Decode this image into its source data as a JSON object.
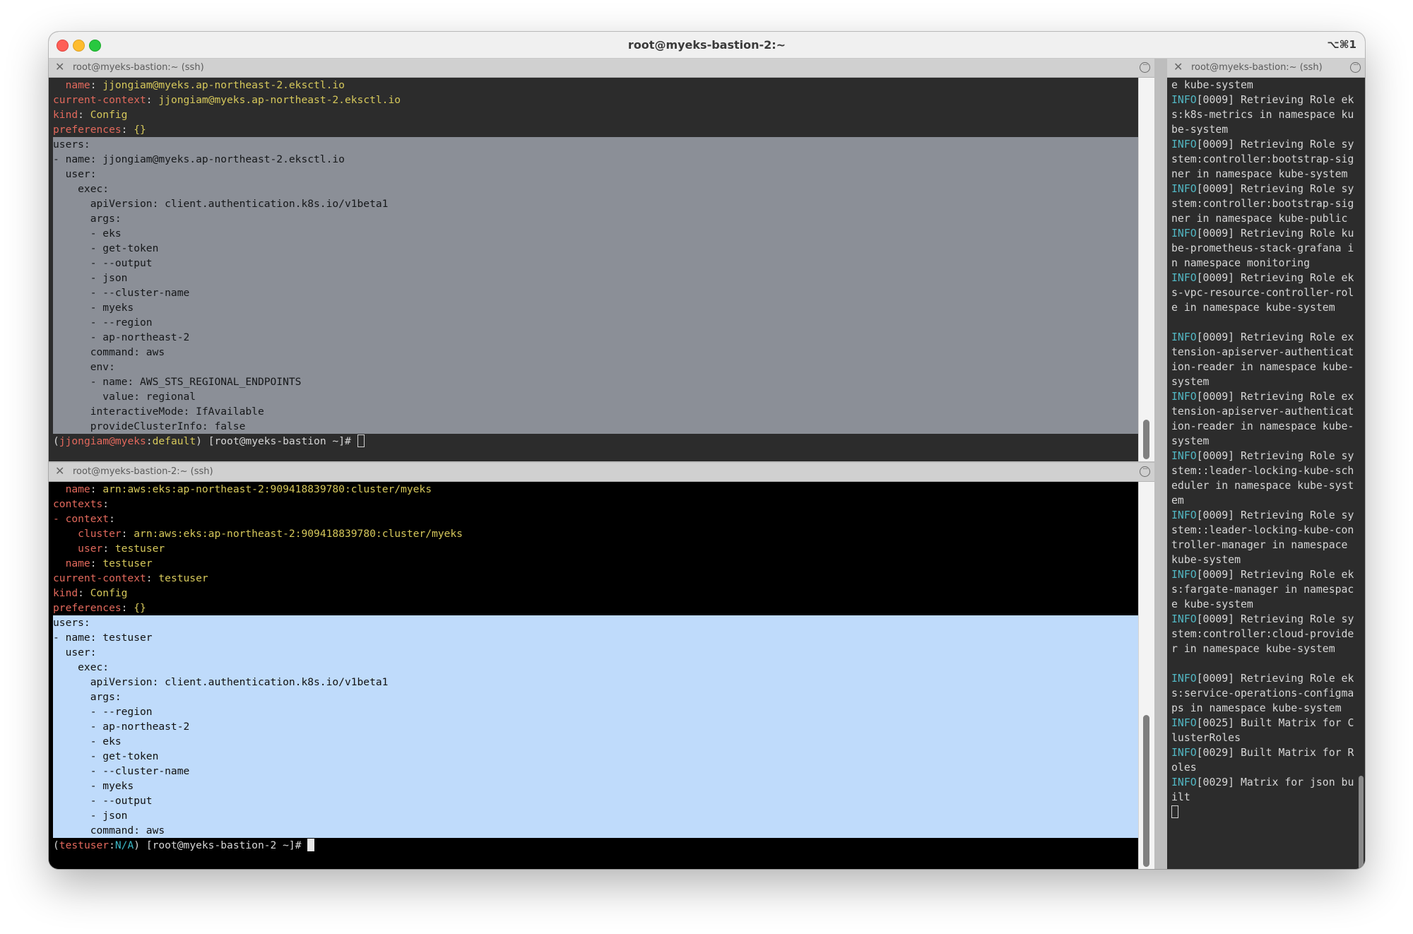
{
  "window": {
    "title": "root@myeks-bastion-2:~",
    "shortcut": "⌥⌘1"
  },
  "colors": {
    "key_red": "#e2695c",
    "key_yellow": "#c9c35e",
    "value_yellow": "#d6c85b",
    "info_cyan": "#52b8c4",
    "prompt_user": "#e2685c",
    "prompt_cluster": "#3bb8c6",
    "plain": "#d6d6d6",
    "pane1_bg": "#2c2c2c",
    "pane2_bg": "#000000",
    "pane3_bg": "#2c2c2c",
    "selection_gray": "#8b8f97",
    "selection_blue": "#bfdbfb"
  },
  "panes": [
    {
      "tab_label": "root@myeks-bastion:~ (ssh)",
      "lines": [
        {
          "seg": [
            {
              "t": "  "
            },
            {
              "t": "name",
              "c": "key_red"
            },
            {
              "t": ": "
            },
            {
              "t": "jjongiam@myeks.ap-northeast-2.eksctl.io",
              "c": "value_yellow"
            }
          ]
        },
        {
          "seg": [
            {
              "t": "current-context",
              "c": "key_red"
            },
            {
              "t": ": "
            },
            {
              "t": "jjongiam@myeks.ap-northeast-2.eksctl.io",
              "c": "value_yellow"
            }
          ]
        },
        {
          "seg": [
            {
              "t": "kind",
              "c": "key_red"
            },
            {
              "t": ": "
            },
            {
              "t": "Config",
              "c": "value_yellow"
            }
          ]
        },
        {
          "seg": [
            {
              "t": "preferences",
              "c": "key_red"
            },
            {
              "t": ": "
            },
            {
              "t": "{}",
              "c": "value_yellow"
            }
          ]
        },
        {
          "sel": true,
          "seg": [
            {
              "t": "users:"
            }
          ]
        },
        {
          "sel": true,
          "seg": [
            {
              "t": "- name: jjongiam@myeks.ap-northeast-2.eksctl.io"
            }
          ]
        },
        {
          "sel": true,
          "seg": [
            {
              "t": "  user:"
            }
          ]
        },
        {
          "sel": true,
          "seg": [
            {
              "t": "    exec:"
            }
          ]
        },
        {
          "sel": true,
          "seg": [
            {
              "t": "      apiVersion: client.authentication.k8s.io/v1beta1"
            }
          ]
        },
        {
          "sel": true,
          "seg": [
            {
              "t": "      args:"
            }
          ]
        },
        {
          "sel": true,
          "seg": [
            {
              "t": "      - eks"
            }
          ]
        },
        {
          "sel": true,
          "seg": [
            {
              "t": "      - get-token"
            }
          ]
        },
        {
          "sel": true,
          "seg": [
            {
              "t": "      - --output"
            }
          ]
        },
        {
          "sel": true,
          "seg": [
            {
              "t": "      - json"
            }
          ]
        },
        {
          "sel": true,
          "seg": [
            {
              "t": "      - --cluster-name"
            }
          ]
        },
        {
          "sel": true,
          "seg": [
            {
              "t": "      - myeks"
            }
          ]
        },
        {
          "sel": true,
          "seg": [
            {
              "t": "      - --region"
            }
          ]
        },
        {
          "sel": true,
          "seg": [
            {
              "t": "      - ap-northeast-2"
            }
          ]
        },
        {
          "sel": true,
          "seg": [
            {
              "t": "      command: aws"
            }
          ]
        },
        {
          "sel": true,
          "seg": [
            {
              "t": "      env:"
            }
          ]
        },
        {
          "sel": true,
          "seg": [
            {
              "t": "      - name: AWS_STS_REGIONAL_ENDPOINTS"
            }
          ]
        },
        {
          "sel": true,
          "seg": [
            {
              "t": "        value: regional"
            }
          ]
        },
        {
          "sel": true,
          "seg": [
            {
              "t": "      interactiveMode: IfAvailable"
            }
          ]
        },
        {
          "sel": true,
          "seg": [
            {
              "t": "      provideClusterInfo: false"
            }
          ]
        },
        {
          "cursor": "hollow",
          "seg": [
            {
              "t": "("
            },
            {
              "t": "jjongiam@myeks",
              "c": "prompt_user"
            },
            {
              "t": ":"
            },
            {
              "t": "default",
              "c": "value_yellow"
            },
            {
              "t": ") [root@myeks-bastion ~]# "
            }
          ]
        }
      ]
    },
    {
      "tab_label": "root@myeks-bastion-2:~ (ssh)",
      "lines": [
        {
          "seg": [
            {
              "t": "  "
            },
            {
              "t": "name",
              "c": "key_red"
            },
            {
              "t": ": "
            },
            {
              "t": "arn:aws:eks:ap-northeast-2:909418839780:cluster/myeks",
              "c": "value_yellow"
            }
          ]
        },
        {
          "seg": [
            {
              "t": "contexts",
              "c": "key_red"
            },
            {
              "t": ":"
            }
          ]
        },
        {
          "seg": [
            {
              "t": "- ",
              "c": "key_red"
            },
            {
              "t": "context",
              "c": "key_red"
            },
            {
              "t": ":"
            }
          ]
        },
        {
          "seg": [
            {
              "t": "    "
            },
            {
              "t": "cluster",
              "c": "key_red"
            },
            {
              "t": ": "
            },
            {
              "t": "arn:aws:eks:ap-northeast-2:909418839780:cluster/myeks",
              "c": "value_yellow"
            }
          ]
        },
        {
          "seg": [
            {
              "t": "    "
            },
            {
              "t": "user",
              "c": "key_red"
            },
            {
              "t": ": "
            },
            {
              "t": "testuser",
              "c": "value_yellow"
            }
          ]
        },
        {
          "seg": [
            {
              "t": "  "
            },
            {
              "t": "name",
              "c": "key_red"
            },
            {
              "t": ": "
            },
            {
              "t": "testuser",
              "c": "value_yellow"
            }
          ]
        },
        {
          "seg": [
            {
              "t": "current-context",
              "c": "key_red"
            },
            {
              "t": ": "
            },
            {
              "t": "testuser",
              "c": "value_yellow"
            }
          ]
        },
        {
          "seg": [
            {
              "t": "kind",
              "c": "key_red"
            },
            {
              "t": ": "
            },
            {
              "t": "Config",
              "c": "value_yellow"
            }
          ]
        },
        {
          "seg": [
            {
              "t": "preferences",
              "c": "key_red"
            },
            {
              "t": ": "
            },
            {
              "t": "{}",
              "c": "value_yellow"
            }
          ]
        },
        {
          "sel": true,
          "seg": [
            {
              "t": "users:"
            }
          ]
        },
        {
          "sel": true,
          "seg": [
            {
              "t": "- name: testuser"
            }
          ]
        },
        {
          "sel": true,
          "seg": [
            {
              "t": "  user:"
            }
          ]
        },
        {
          "sel": true,
          "seg": [
            {
              "t": "    exec:"
            }
          ]
        },
        {
          "sel": true,
          "seg": [
            {
              "t": "      apiVersion: client.authentication.k8s.io/v1beta1"
            }
          ]
        },
        {
          "sel": true,
          "seg": [
            {
              "t": "      args:"
            }
          ]
        },
        {
          "sel": true,
          "seg": [
            {
              "t": "      - --region"
            }
          ]
        },
        {
          "sel": true,
          "seg": [
            {
              "t": "      - ap-northeast-2"
            }
          ]
        },
        {
          "sel": true,
          "seg": [
            {
              "t": "      - eks"
            }
          ]
        },
        {
          "sel": true,
          "seg": [
            {
              "t": "      - get-token"
            }
          ]
        },
        {
          "sel": true,
          "seg": [
            {
              "t": "      - --cluster-name"
            }
          ]
        },
        {
          "sel": true,
          "seg": [
            {
              "t": "      - myeks"
            }
          ]
        },
        {
          "sel": true,
          "seg": [
            {
              "t": "      - --output"
            }
          ]
        },
        {
          "sel": true,
          "seg": [
            {
              "t": "      - json"
            }
          ]
        },
        {
          "sel": true,
          "seg": [
            {
              "t": "      command: aws"
            }
          ]
        },
        {
          "cursor": "block",
          "seg": [
            {
              "t": "("
            },
            {
              "t": "testuser",
              "c": "prompt_user"
            },
            {
              "t": ":"
            },
            {
              "t": "N/A",
              "c": "prompt_cluster"
            },
            {
              "t": ") [root@myeks-bastion-2 ~]# "
            }
          ]
        }
      ]
    },
    {
      "tab_label": "root@myeks-bastion:~ (ssh)",
      "lines": [
        {
          "seg": [
            {
              "t": "e kube-system"
            }
          ]
        },
        {
          "seg": [
            {
              "t": "INFO",
              "c": "info_cyan"
            },
            {
              "t": "[0009] Retrieving Role eks:k8s-metrics in namespace kube-system"
            }
          ]
        },
        {
          "seg": [
            {
              "t": "INFO",
              "c": "info_cyan"
            },
            {
              "t": "[0009] Retrieving Role system:controller:bootstrap-signer in namespace kube-system"
            }
          ]
        },
        {
          "seg": [
            {
              "t": "INFO",
              "c": "info_cyan"
            },
            {
              "t": "[0009] Retrieving Role system:controller:bootstrap-signer in namespace kube-public"
            }
          ]
        },
        {
          "seg": [
            {
              "t": "INFO",
              "c": "info_cyan"
            },
            {
              "t": "[0009] Retrieving Role kube-prometheus-stack-grafana in namespace monitoring"
            }
          ]
        },
        {
          "seg": [
            {
              "t": "INFO",
              "c": "info_cyan"
            },
            {
              "t": "[0009] Retrieving Role eks-vpc-resource-controller-role in namespace kube-system"
            }
          ]
        },
        {
          "seg": [
            {
              "t": " "
            }
          ]
        },
        {
          "seg": [
            {
              "t": "INFO",
              "c": "info_cyan"
            },
            {
              "t": "[0009] Retrieving Role extension-apiserver-authentication-reader in namespace kube-system"
            }
          ]
        },
        {
          "seg": [
            {
              "t": "INFO",
              "c": "info_cyan"
            },
            {
              "t": "[0009] Retrieving Role extension-apiserver-authentication-reader in namespace kube-system"
            }
          ]
        },
        {
          "seg": [
            {
              "t": "INFO",
              "c": "info_cyan"
            },
            {
              "t": "[0009] Retrieving Role system::leader-locking-kube-scheduler in namespace kube-system"
            }
          ]
        },
        {
          "seg": [
            {
              "t": "INFO",
              "c": "info_cyan"
            },
            {
              "t": "[0009] Retrieving Role system::leader-locking-kube-controller-manager in namespace kube-system"
            }
          ]
        },
        {
          "seg": [
            {
              "t": "INFO",
              "c": "info_cyan"
            },
            {
              "t": "[0009] Retrieving Role eks:fargate-manager in namespace kube-system"
            }
          ]
        },
        {
          "seg": [
            {
              "t": "INFO",
              "c": "info_cyan"
            },
            {
              "t": "[0009] Retrieving Role system:controller:cloud-provider in namespace kube-system"
            }
          ]
        },
        {
          "seg": [
            {
              "t": " "
            }
          ]
        },
        {
          "seg": [
            {
              "t": "INFO",
              "c": "info_cyan"
            },
            {
              "t": "[0009] Retrieving Role eks:service-operations-configmaps in namespace kube-system"
            }
          ]
        },
        {
          "seg": [
            {
              "t": "INFO",
              "c": "info_cyan"
            },
            {
              "t": "[0025] Built Matrix for ClusterRoles"
            }
          ]
        },
        {
          "seg": [
            {
              "t": "INFO",
              "c": "info_cyan"
            },
            {
              "t": "[0029] Built Matrix for Roles"
            }
          ]
        },
        {
          "seg": [
            {
              "t": "INFO",
              "c": "info_cyan"
            },
            {
              "t": "[0029] Matrix for json built"
            }
          ]
        },
        {
          "cursor": "hollow",
          "seg": []
        }
      ]
    }
  ]
}
